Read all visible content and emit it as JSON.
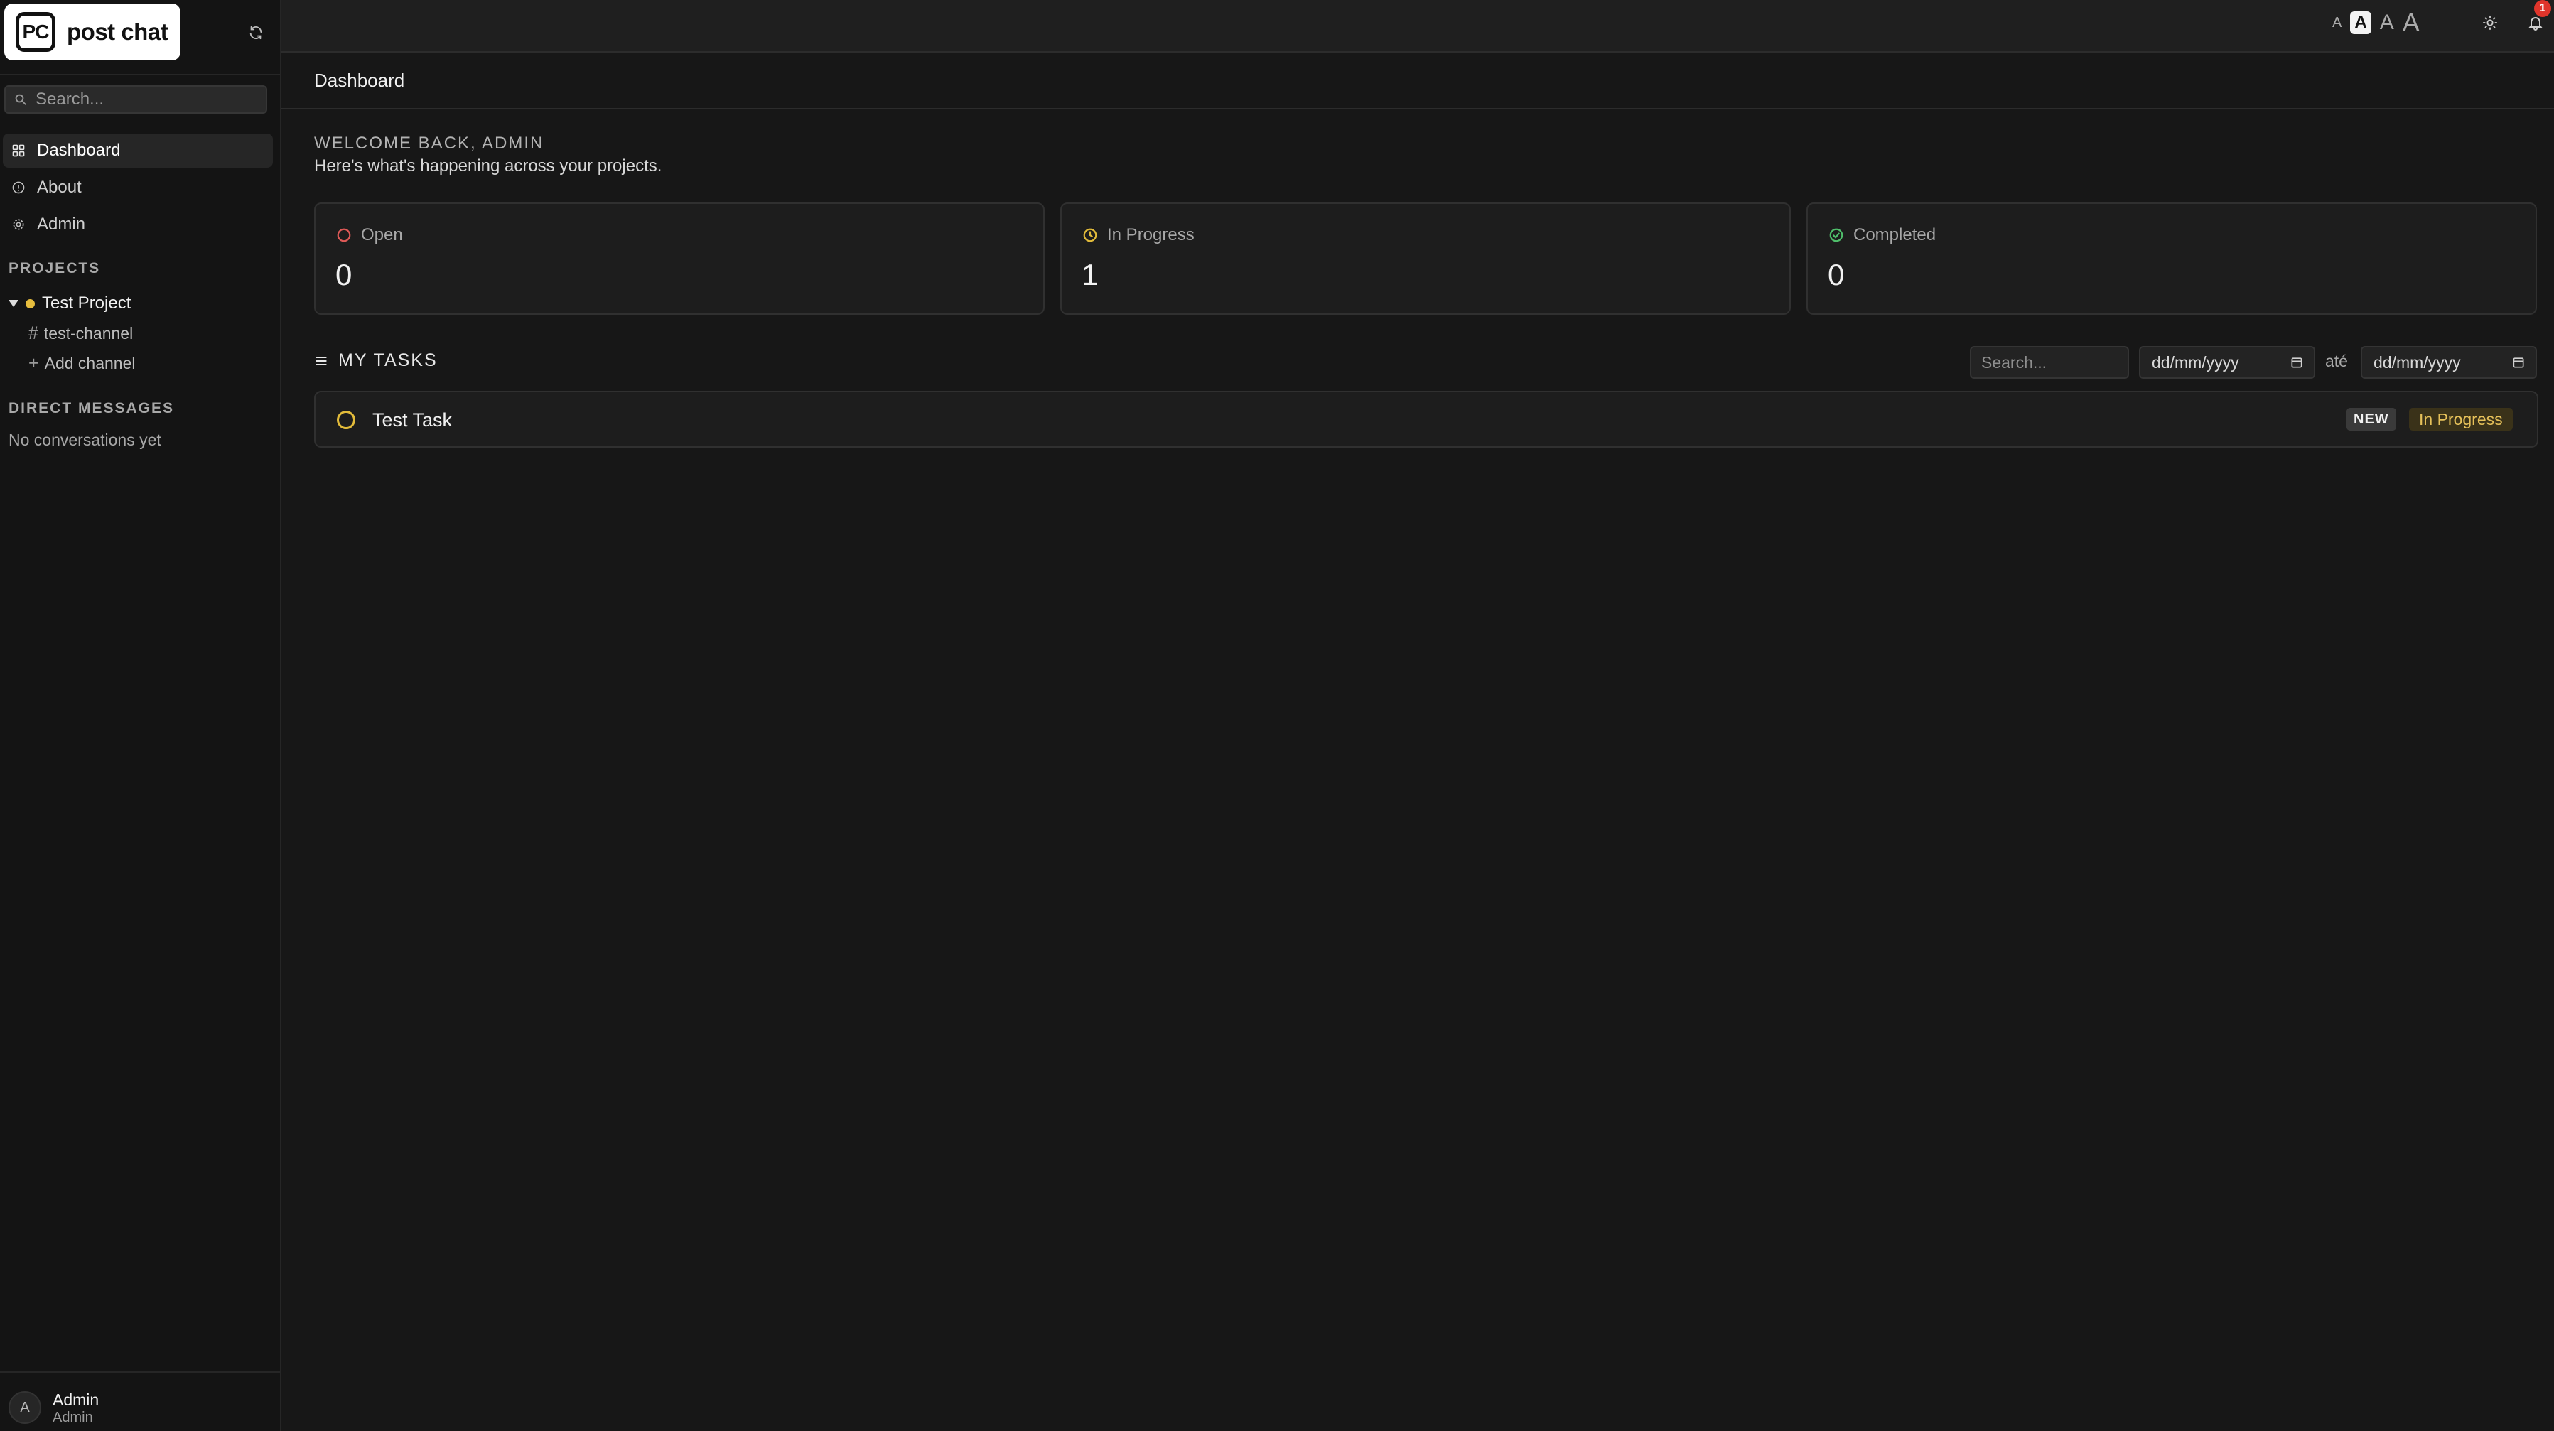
{
  "app": {
    "logo_mark": "PC",
    "logo_text": "post chat"
  },
  "sidebar": {
    "search_placeholder": "Search...",
    "nav": [
      {
        "label": "Dashboard",
        "icon": "grid-icon",
        "active": true
      },
      {
        "label": "About",
        "icon": "info-icon",
        "active": false
      },
      {
        "label": "Admin",
        "icon": "gear-icon",
        "active": false
      }
    ],
    "projects_label": "PROJECTS",
    "project": {
      "name": "Test Project",
      "color": "#e6bd3e"
    },
    "channels": [
      {
        "symbol": "#",
        "label": "test-channel"
      }
    ],
    "add_channel": {
      "symbol": "+",
      "label": "Add channel"
    },
    "dm_label": "DIRECT MESSAGES",
    "no_conversations": "No conversations yet",
    "user": {
      "avatar_letter": "A",
      "name": "Admin",
      "role": "Admin"
    }
  },
  "topbar": {
    "font_sizes": [
      "A",
      "A",
      "A",
      "A"
    ],
    "selected_font_size_index": 1,
    "notification_count": "1"
  },
  "breadcrumb": "Dashboard",
  "main": {
    "welcome": "WELCOME BACK, ADMIN",
    "subtitle": "Here's what's happening across your projects.",
    "stats": [
      {
        "label": "Open",
        "value": "0",
        "color": "#e05a57",
        "icon": "circle-icon"
      },
      {
        "label": "In Progress",
        "value": "1",
        "color": "#e2bb3a",
        "icon": "clock-icon"
      },
      {
        "label": "Completed",
        "value": "0",
        "color": "#4fbf6b",
        "icon": "check-circle-icon"
      }
    ],
    "tasks_title": "MY TASKS",
    "filter_search_placeholder": "Search...",
    "date_from_placeholder": "dd/mm/yyyy",
    "date_separator": "até",
    "date_to_placeholder": "dd/mm/yyyy",
    "tasks": [
      {
        "title": "Test Task",
        "badge": "NEW",
        "status": "In Progress",
        "status_color": "#e6c15a"
      }
    ]
  }
}
